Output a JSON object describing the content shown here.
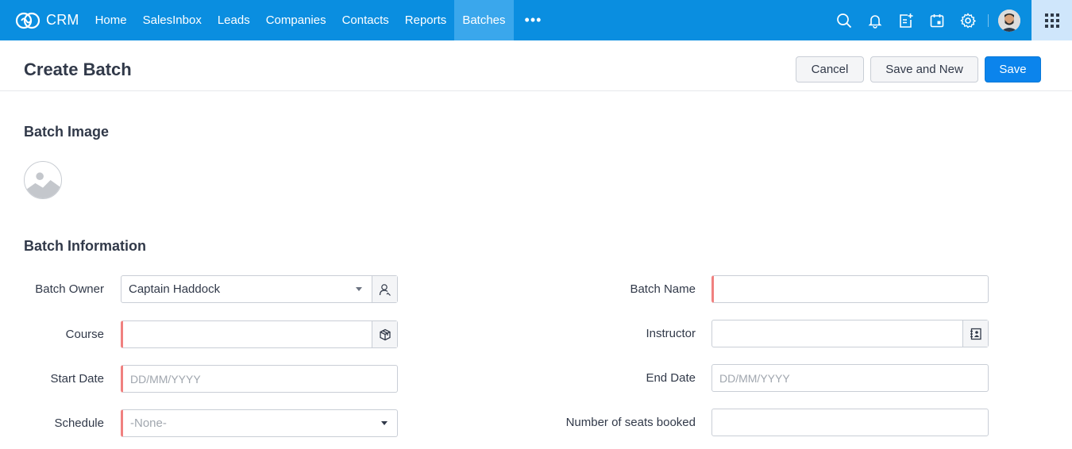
{
  "app": {
    "brand": "CRM",
    "nav": [
      {
        "label": "Home",
        "active": false
      },
      {
        "label": "SalesInbox",
        "active": false
      },
      {
        "label": "Leads",
        "active": false
      },
      {
        "label": "Companies",
        "active": false
      },
      {
        "label": "Contacts",
        "active": false
      },
      {
        "label": "Reports",
        "active": false
      },
      {
        "label": "Batches",
        "active": true
      }
    ],
    "more_label": "•••",
    "right_icons": [
      "search-icon",
      "bell-icon",
      "add-note-icon",
      "calendar-icon",
      "gear-icon",
      "avatar",
      "apps-grid-icon"
    ],
    "colors": {
      "topbar": "#0a8ee0",
      "active_tab": "#3aa7ec",
      "primary_button": "#0b84ec",
      "required_marker": "#f0807f"
    }
  },
  "header": {
    "title": "Create Batch",
    "buttons": {
      "cancel": "Cancel",
      "save_and_new": "Save and New",
      "save": "Save"
    }
  },
  "sections": {
    "image_title": "Batch Image",
    "info_title": "Batch Information"
  },
  "form": {
    "batch_owner": {
      "label": "Batch Owner",
      "value": "Captain Haddock"
    },
    "batch_name": {
      "label": "Batch Name",
      "value": ""
    },
    "course": {
      "label": "Course",
      "value": ""
    },
    "instructor": {
      "label": "Instructor",
      "value": ""
    },
    "start_date": {
      "label": "Start Date",
      "placeholder": "DD/MM/YYYY"
    },
    "end_date": {
      "label": "End Date",
      "placeholder": "DD/MM/YYYY"
    },
    "schedule": {
      "label": "Schedule",
      "value": "-None-"
    },
    "seats_booked": {
      "label": "Number of seats booked",
      "value": ""
    }
  }
}
